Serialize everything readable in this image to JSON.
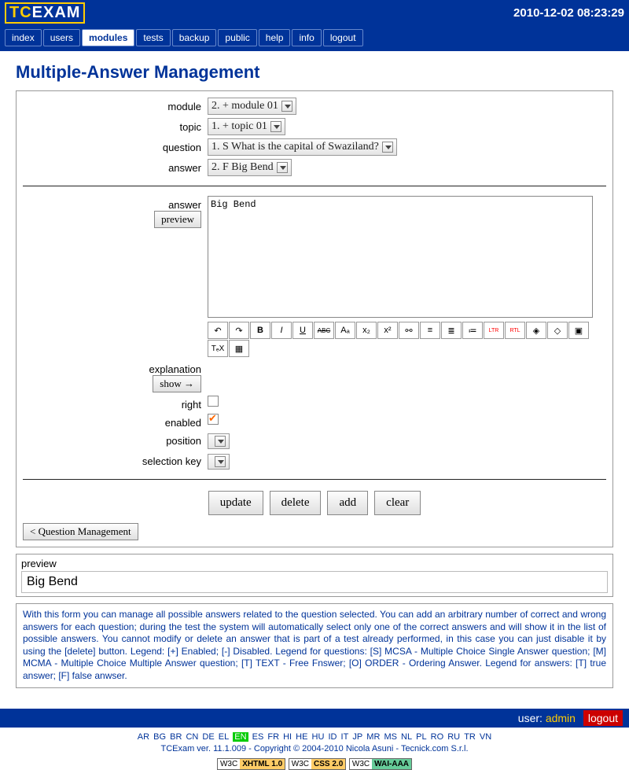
{
  "header": {
    "logo_tc": "TC",
    "logo_exam": "EXAM",
    "timestamp": "2010-12-02 08:23:29"
  },
  "nav": [
    "index",
    "users",
    "modules",
    "tests",
    "backup",
    "public",
    "help",
    "info",
    "logout"
  ],
  "nav_active_index": 2,
  "page_title": "Multiple-Answer Management",
  "form": {
    "module": {
      "label": "module",
      "value": "2. + module 01"
    },
    "topic": {
      "label": "topic",
      "value": "1. + topic 01"
    },
    "question": {
      "label": "question",
      "value": "1. S What is the capital of Swaziland?"
    },
    "answer": {
      "label": "answer",
      "value": "2. F Big Bend"
    },
    "answer_text": {
      "label": "answer",
      "value": "Big Bend",
      "preview_btn": "preview"
    },
    "explanation": {
      "label": "explanation",
      "show_btn": "show →"
    },
    "right": {
      "label": "right",
      "checked": false
    },
    "enabled": {
      "label": "enabled",
      "checked": true
    },
    "position": {
      "label": "position",
      "value": ""
    },
    "keyboard_key": {
      "label": "selection key",
      "value": ""
    }
  },
  "toolbar_icons": [
    {
      "name": "undo-icon",
      "txt": "↶"
    },
    {
      "name": "redo-icon",
      "txt": "↷"
    },
    {
      "name": "bold-icon",
      "txt": "B",
      "style": "font-weight:bold"
    },
    {
      "name": "italic-icon",
      "txt": "I",
      "style": "font-style:italic"
    },
    {
      "name": "underline-icon",
      "txt": "U",
      "style": "text-decoration:underline"
    },
    {
      "name": "strike-icon",
      "txt": "ABC",
      "style": "text-decoration:line-through;font-size:8px"
    },
    {
      "name": "font-small-icon",
      "txt": "Aₐ"
    },
    {
      "name": "subscript-icon",
      "txt": "x₂"
    },
    {
      "name": "superscript-icon",
      "txt": "x²"
    },
    {
      "name": "link-icon",
      "txt": "⚯"
    },
    {
      "name": "list-ul-icon",
      "txt": "≡"
    },
    {
      "name": "list-ol-icon",
      "txt": "≣"
    },
    {
      "name": "list-item-icon",
      "txt": "≔"
    },
    {
      "name": "ltr-icon",
      "txt": "LTR",
      "style": "font-size:7px;color:red"
    },
    {
      "name": "rtl-icon",
      "txt": "RTL",
      "style": "font-size:7px;color:red"
    },
    {
      "name": "color-icon",
      "txt": "◈"
    },
    {
      "name": "object-icon",
      "txt": "◇"
    },
    {
      "name": "image-icon",
      "txt": "▣"
    },
    {
      "name": "tex-icon",
      "txt": "TₑX",
      "style": "font-size:10px"
    },
    {
      "name": "media-icon",
      "txt": "▦"
    }
  ],
  "buttons": {
    "update": "update",
    "delete": "delete",
    "add": "add",
    "clear": "clear",
    "back": "< Question Management"
  },
  "preview": {
    "label": "preview",
    "content": "Big Bend"
  },
  "help_text": "With this form you can manage all possible answers related to the question selected. You can add an arbitrary number of correct and wrong answers for each question; during the test the system will automatically select only one of the correct answers and will show it in the list of possible answers. You cannot modify or delete an answer that is part of a test already performed, in this case you can just disable it by using the [delete] button. Legend: [+] Enabled; [-] Disabled. Legend for questions: [S] MCSA - Multiple Choice Single Answer question; [M] MCMA - Multiple Choice Multiple Answer question; [T] TEXT - Free Fnswer; [O] ORDER - Ordering Answer. Legend for answers: [T] true answer; [F] false anwser.",
  "footer": {
    "user_label": "user:",
    "user": "admin",
    "logout": "logout"
  },
  "langs": [
    "AR",
    "BG",
    "BR",
    "CN",
    "DE",
    "EL",
    "EN",
    "ES",
    "FR",
    "HI",
    "HE",
    "HU",
    "ID",
    "IT",
    "JP",
    "MR",
    "MS",
    "NL",
    "PL",
    "RO",
    "RU",
    "TR",
    "VN"
  ],
  "lang_active": "EN",
  "credits": {
    "prefix": "TCExam",
    "ver": " ver. 11.1.009 - Copyright © 2004-2010 Nicola Asuni - ",
    "link": "Tecnick.com S.r.l."
  },
  "badges": [
    {
      "l": "W3C",
      "r": "XHTML 1.0",
      "color": "#ffcc66"
    },
    {
      "l": "W3C",
      "r": "CSS 2.0",
      "color": "#ffcc66"
    },
    {
      "l": "W3C",
      "r": "WAI-AAA",
      "color": "#66cc99"
    }
  ]
}
